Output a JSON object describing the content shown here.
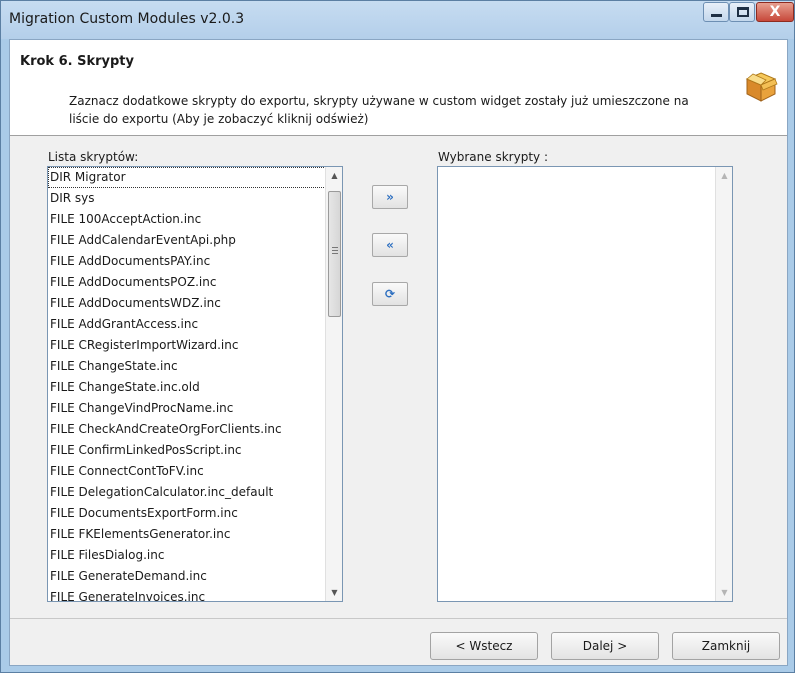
{
  "window": {
    "title": "Migration Custom Modules v2.0.3",
    "controls": {
      "minimize_icon": "minimize-icon",
      "maximize_icon": "maximize-icon",
      "close_glyph": "X"
    }
  },
  "header": {
    "step_title": "Krok 6. Skrypty",
    "description": "Zaznacz dodatkowe skrypty do exportu, skrypty używane w custom widget zostały już umieszczone na liście do exportu (Aby je zobaczyć kliknij odśwież)",
    "icon": "package-box-icon"
  },
  "left_list": {
    "label": "Lista skryptów:",
    "items": [
      "DIR Migrator",
      "DIR sys",
      "FILE 100AcceptAction.inc",
      "FILE AddCalendarEventApi.php",
      "FILE AddDocumentsPAY.inc",
      "FILE AddDocumentsPOZ.inc",
      "FILE AddDocumentsWDZ.inc",
      "FILE AddGrantAccess.inc",
      "FILE CRegisterImportWizard.inc",
      "FILE ChangeState.inc",
      "FILE ChangeState.inc.old",
      "FILE ChangeVindProcName.inc",
      "FILE CheckAndCreateOrgForClients.inc",
      "FILE ConfirmLinkedPosScript.inc",
      "FILE ConnectContToFV.inc",
      "FILE DelegationCalculator.inc_default",
      "FILE DocumentsExportForm.inc",
      "FILE FKElementsGenerator.inc",
      "FILE FilesDialog.inc",
      "FILE GenerateDemand.inc",
      "FILE GenerateInvoices.inc"
    ],
    "selected_index": 0
  },
  "right_list": {
    "label": "Wybrane skrypty :",
    "items": []
  },
  "transfer_buttons": {
    "add_glyph": "»",
    "remove_glyph": "«",
    "refresh_glyph": "⟳"
  },
  "footer": {
    "back_label": "< Wstecz",
    "next_label": "Dalej >",
    "close_label": "Zamknij"
  },
  "colors": {
    "accent": "#2d6fc0",
    "titlebar": "#b4cfea",
    "close_button": "#c7483a"
  }
}
